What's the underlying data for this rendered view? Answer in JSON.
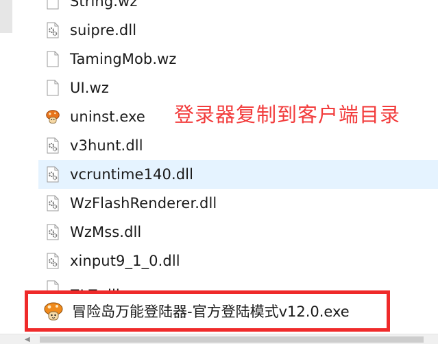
{
  "files": [
    {
      "name": "String.wz",
      "type": "file"
    },
    {
      "name": "suipre.dll",
      "type": "dll"
    },
    {
      "name": "TamingMob.wz",
      "type": "file"
    },
    {
      "name": "UI.wz",
      "type": "file"
    },
    {
      "name": "uninst.exe",
      "type": "exe"
    },
    {
      "name": "v3hunt.dll",
      "type": "dll"
    },
    {
      "name": "vcruntime140.dll",
      "type": "dll"
    },
    {
      "name": "WzFlashRenderer.dll",
      "type": "dll"
    },
    {
      "name": "WzMss.dll",
      "type": "dll"
    },
    {
      "name": "xinput9_1_0.dll",
      "type": "dll"
    },
    {
      "name": "ZLZ.dll",
      "type": "dll"
    }
  ],
  "annotation": "登录器复制到客户端目录",
  "highlighted_file": {
    "name": "冒险岛万能登陆器-官方登陆模式v12.0.exe",
    "type": "exe"
  },
  "icons": {
    "file": "file-icon",
    "dll": "gear-file-icon",
    "exe": "mushroom-icon"
  },
  "colors": {
    "annotation": "#f23c3c",
    "highlight_border": "#ef2a2a",
    "selected_row": "#e5f3ff"
  },
  "scrollbar": {
    "left_arrow": "◀"
  }
}
